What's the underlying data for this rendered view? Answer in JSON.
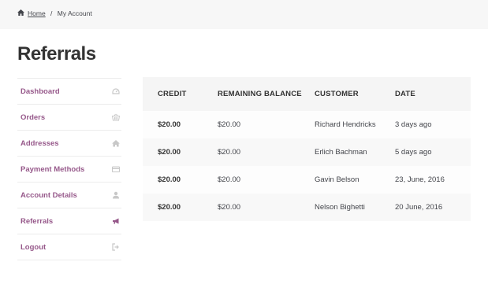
{
  "breadcrumb": {
    "home_label": "Home",
    "separator": " / ",
    "current": "My Account"
  },
  "page": {
    "title": "Referrals"
  },
  "nav": {
    "accent_color": "#96588a",
    "items": [
      {
        "label": "Dashboard",
        "icon": "dashboard-icon"
      },
      {
        "label": "Orders",
        "icon": "basket-icon"
      },
      {
        "label": "Addresses",
        "icon": "home-icon"
      },
      {
        "label": "Payment Methods",
        "icon": "credit-card-icon"
      },
      {
        "label": "Account Details",
        "icon": "user-icon"
      },
      {
        "label": "Referrals",
        "icon": "megaphone-icon",
        "active": true
      },
      {
        "label": "Logout",
        "icon": "sign-out-icon"
      }
    ]
  },
  "table": {
    "headers": [
      "CREDIT",
      "REMAINING BALANCE",
      "CUSTOMER",
      "DATE"
    ],
    "rows": [
      {
        "credit": "$20.00",
        "remaining": "$20.00",
        "customer": "Richard Hendricks",
        "date": "3 days ago"
      },
      {
        "credit": "$20.00",
        "remaining": "$20.00",
        "customer": "Erlich Bachman",
        "date": "5 days ago"
      },
      {
        "credit": "$20.00",
        "remaining": "$20.00",
        "customer": "Gavin Belson",
        "date": "23, June, 2016"
      },
      {
        "credit": "$20.00",
        "remaining": "$20.00",
        "customer": "Nelson Bighetti",
        "date": "20 June, 2016"
      }
    ]
  }
}
